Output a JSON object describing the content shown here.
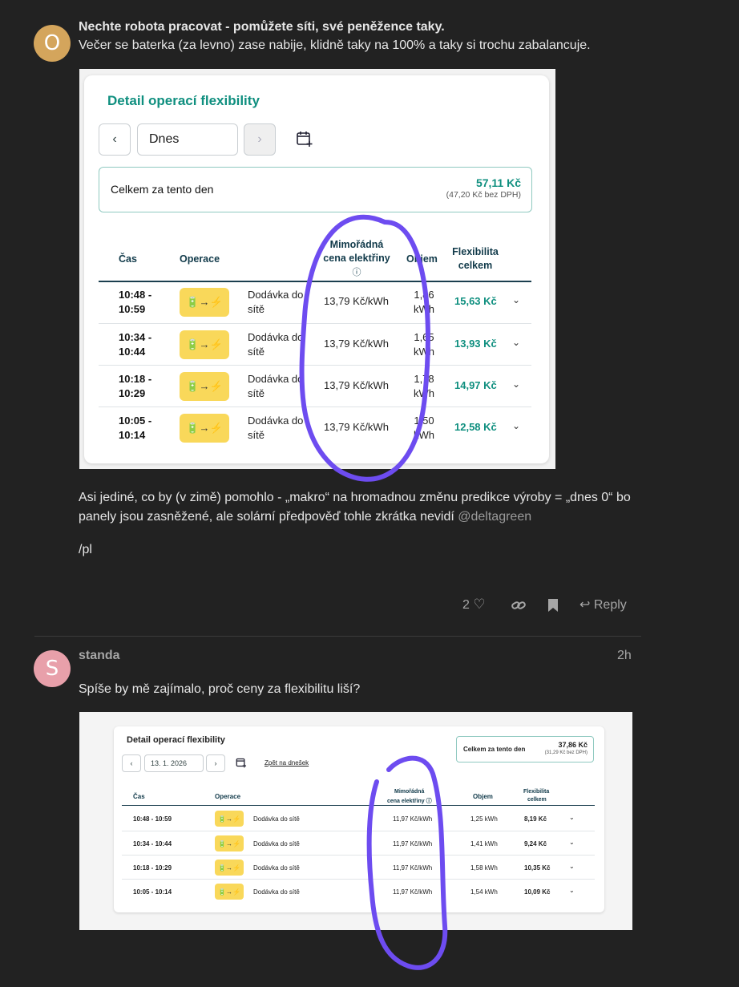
{
  "post1": {
    "avatar_letter": "O",
    "avatar_color": "#d4a55c",
    "line1": "Nechte robota pracovat - pomůžete síti, své peněžence taky.",
    "line2": "Večer se baterka (za levno) zase nabije, klidně taky na 100% a taky si trochu zabalancuje.",
    "screenshot": {
      "title": "Detail operací flexibility",
      "date": "Dnes",
      "total_label": "Celkem za tento den",
      "total_value": "57,11 Kč",
      "total_sub": "(47,20 Kč bez DPH)",
      "headers": {
        "time": "Čas",
        "operation": "Operace",
        "price": "Mimořádná cena elektřiny",
        "price_info": "ⓘ",
        "volume": "Objem",
        "flex": "Flexibilita celkem"
      },
      "operation_icon": "battery-to-grid-icon",
      "rows": [
        {
          "time_a": "10:48 -",
          "time_b": "10:59",
          "op": "Dodávka do sítě",
          "op_a": "Dodávka do",
          "op_b": "sítě",
          "price": "13,79 Kč/kWh",
          "vol_a": "1,86",
          "vol_b": "kWh",
          "flex": "15,63 Kč"
        },
        {
          "time_a": "10:34 -",
          "time_b": "10:44",
          "op": "Dodávka do sítě",
          "op_a": "Dodávka do",
          "op_b": "sítě",
          "price": "13,79 Kč/kWh",
          "vol_a": "1,65",
          "vol_b": "kWh",
          "flex": "13,93 Kč"
        },
        {
          "time_a": "10:18 -",
          "time_b": "10:29",
          "op": "Dodávka do sítě",
          "op_a": "Dodávka do",
          "op_b": "sítě",
          "price": "13,79 Kč/kWh",
          "vol_a": "1,78",
          "vol_b": "kWh",
          "flex": "14,97 Kč"
        },
        {
          "time_a": "10:05 -",
          "time_b": "10:14",
          "op": "Dodávka do sítě",
          "op_a": "Dodávka do",
          "op_b": "sítě",
          "price": "13,79 Kč/kWh",
          "vol_a": "1,50",
          "vol_b": "kWh",
          "flex": "12,58 Kč"
        }
      ]
    },
    "para1_line1": "Asi jediné, co by (v zimě) pomohlo - „makro“ na hromadnou změnu predikce výroby = „dnes 0“ bo",
    "para1_line2": "panely jsou zasněžené, ale solární předpověď tohle zkrátka nevidí",
    "mention": "@deltagreen",
    "signature": "/pl",
    "likes": "2",
    "reply_label": "Reply"
  },
  "post2": {
    "avatar_letter": "S",
    "avatar_color": "#e8a0aa",
    "username": "standa",
    "time_ago": "2h",
    "text": "Spíše by mě zajímalo, proč ceny za flexibilitu liší?",
    "screenshot": {
      "title": "Detail operací flexibility",
      "date": "13. 1. 2026",
      "back_today": "Zpět na dnešek",
      "total_label": "Celkem za tento den",
      "total_value": "37,86 Kč",
      "total_sub": "(31,29 Kč bez DPH)",
      "headers": {
        "time": "Čas",
        "operation": "Operace",
        "price_a": "Mimořádná",
        "price_b": "cena elektřiny ⓘ",
        "volume": "Objem",
        "flex_a": "Flexibilita",
        "flex_b": "celkem"
      },
      "rows": [
        {
          "time": "10:48 - 10:59",
          "op": "Dodávka do sítě",
          "price": "11,97 Kč/kWh",
          "vol": "1,25 kWh",
          "flex": "8,19 Kč"
        },
        {
          "time": "10:34 - 10:44",
          "op": "Dodávka do sítě",
          "price": "11,97 Kč/kWh",
          "vol": "1,41 kWh",
          "flex": "9,24 Kč"
        },
        {
          "time": "10:18 - 10:29",
          "op": "Dodávka do sítě",
          "price": "11,97 Kč/kWh",
          "vol": "1,58 kWh",
          "flex": "10,35 Kč"
        },
        {
          "time": "10:05 - 10:14",
          "op": "Dodávka do sítě",
          "price": "11,97 Kč/kWh",
          "vol": "1,54 kWh",
          "flex": "10,09 Kč"
        }
      ]
    }
  },
  "colors": {
    "background": "#222222",
    "accent_teal": "#0f8f7f",
    "badge_yellow": "#f9d85a",
    "annotation_purple": "#6d4cf0"
  }
}
